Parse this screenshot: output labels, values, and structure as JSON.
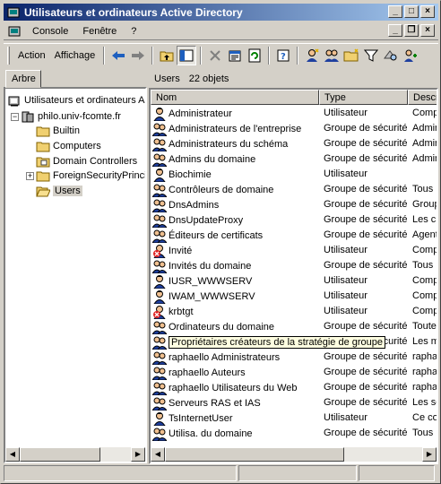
{
  "window": {
    "title": "Utilisateurs et ordinateurs Active Directory",
    "active_title_color": "#0a246a"
  },
  "menu": [
    "Console",
    "Fenêtre",
    "?"
  ],
  "toolbar": {
    "action": "Action",
    "view": "Affichage"
  },
  "tree": {
    "tab": "Arbre",
    "root": "Utilisateurs et ordinateurs Active Directory",
    "domain": "philo.univ-fcomte.fr",
    "children": [
      "Builtin",
      "Computers",
      "Domain Controllers",
      "ForeignSecurityPrincipals",
      "Users"
    ],
    "selected": "Users"
  },
  "list": {
    "container": "Users",
    "count": "22 objets",
    "columns": [
      "Nom",
      "Type",
      "Description"
    ],
    "rows": [
      {
        "name": "Administrateur",
        "type": "Utilisateur",
        "desc": "Compte d'utilisateur",
        "icon": "user-icon"
      },
      {
        "name": "Administrateurs de l'entreprise",
        "type": "Groupe de sécurité",
        "desc": "Administrateurs",
        "icon": "group-icon"
      },
      {
        "name": "Administrateurs du schéma",
        "type": "Groupe de sécurité",
        "desc": "Administrateurs",
        "icon": "group-icon"
      },
      {
        "name": "Admins du domaine",
        "type": "Groupe de sécurité",
        "desc": "Administrateurs",
        "icon": "group-icon"
      },
      {
        "name": "Biochimie",
        "type": "Utilisateur",
        "desc": "",
        "icon": "user-icon"
      },
      {
        "name": "Contrôleurs de domaine",
        "type": "Groupe de sécurité",
        "desc": "Tous les",
        "icon": "group-icon"
      },
      {
        "name": "DnsAdmins",
        "type": "Groupe de sécurité",
        "desc": "Groupe",
        "icon": "group-icon"
      },
      {
        "name": "DnsUpdateProxy",
        "type": "Groupe de sécurité",
        "desc": "Les clients",
        "icon": "group-icon"
      },
      {
        "name": "Éditeurs de certificats",
        "type": "Groupe de sécurité",
        "desc": "Agents",
        "icon": "group-icon"
      },
      {
        "name": "Invité",
        "type": "Utilisateur",
        "desc": "Compte",
        "icon": "disabled-user-icon"
      },
      {
        "name": "Invités du domaine",
        "type": "Groupe de sécurité",
        "desc": "Tous les",
        "icon": "group-icon"
      },
      {
        "name": "IUSR_WWWSERV",
        "type": "Utilisateur",
        "desc": "Compte",
        "icon": "user-icon"
      },
      {
        "name": "IWAM_WWWSERV",
        "type": "Utilisateur",
        "desc": "Compte",
        "icon": "user-icon"
      },
      {
        "name": "krbtgt",
        "type": "Utilisateur",
        "desc": "Compte",
        "icon": "disabled-user-icon"
      },
      {
        "name": "Ordinateurs du domaine",
        "type": "Groupe de sécurité",
        "desc": "Toutes",
        "icon": "group-icon"
      },
      {
        "name": "Propriétaires créateurs de la stratégie de groupe",
        "type": "Groupe de sécurité",
        "desc": "Les membres",
        "icon": "group-icon",
        "tooltip": true
      },
      {
        "name": "raphaello Administrateurs",
        "type": "Groupe de sécurité",
        "desc": "raphaello",
        "icon": "group-icon"
      },
      {
        "name": "raphaello Auteurs",
        "type": "Groupe de sécurité",
        "desc": "raphaello",
        "icon": "group-icon"
      },
      {
        "name": "raphaello Utilisateurs du Web",
        "type": "Groupe de sécurité",
        "desc": "raphaello",
        "icon": "group-icon"
      },
      {
        "name": "Serveurs RAS et IAS",
        "type": "Groupe de sécurité",
        "desc": "Les serveurs",
        "icon": "group-icon"
      },
      {
        "name": "TsInternetUser",
        "type": "Utilisateur",
        "desc": "Ce compte",
        "icon": "user-icon"
      },
      {
        "name": "Utilisa. du domaine",
        "type": "Groupe de sécurité",
        "desc": "Tous les",
        "icon": "group-icon"
      }
    ]
  }
}
